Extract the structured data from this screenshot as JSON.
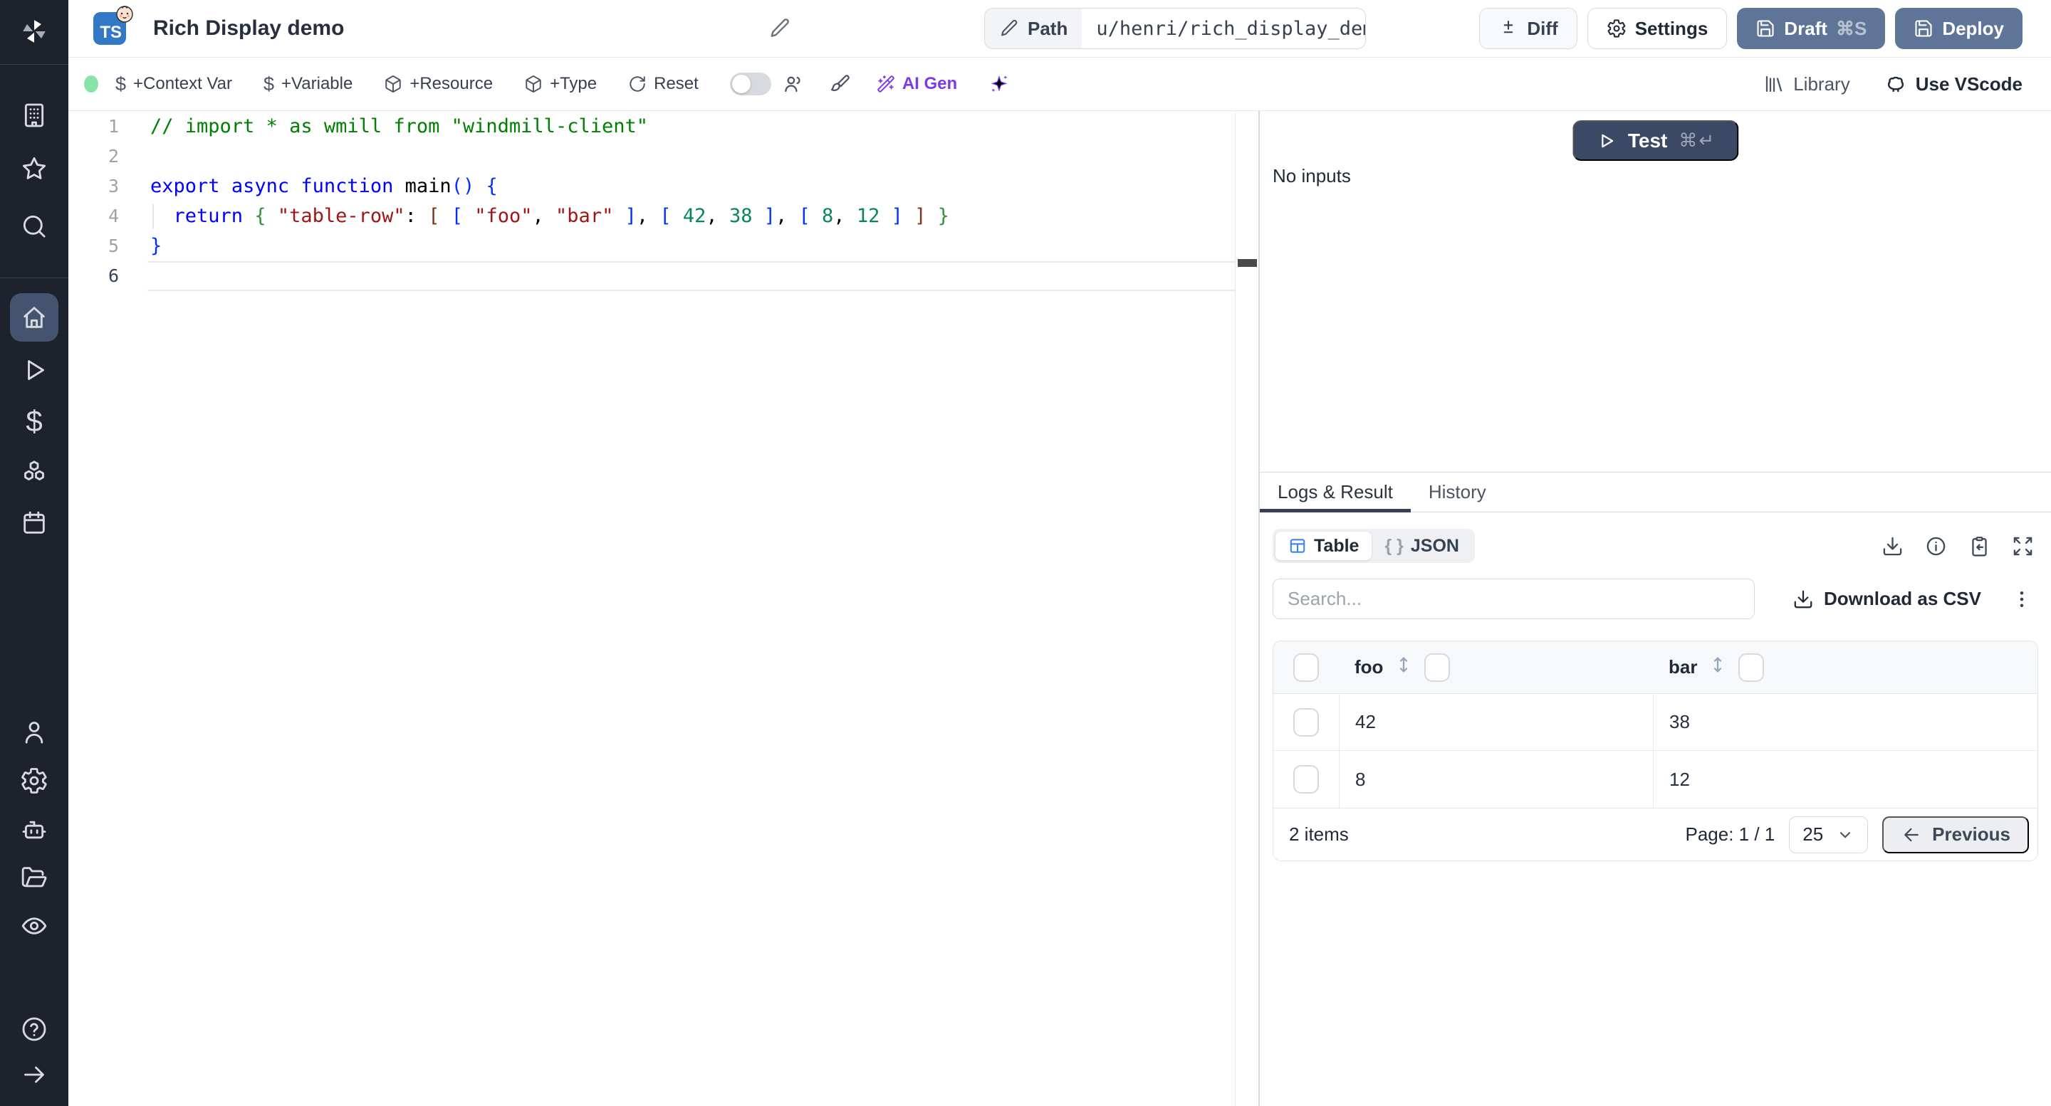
{
  "colors": {
    "accent_blue": "#5f7598",
    "dark_navy": "#3b4964",
    "ai_purple": "#7c3aed",
    "status_green": "#87e3a6",
    "table_icon_blue": "#3b82f6",
    "ts_badge_blue": "#3178c6",
    "sidebar_bg": "#1e222c",
    "sidebar_active_bg": "#44536e"
  },
  "sidebar": {
    "icons": [
      "windmill-logo",
      "building",
      "star",
      "search",
      "home",
      "play",
      "dollar",
      "boxes",
      "calendar",
      "user",
      "settings",
      "worker",
      "folder-open",
      "eye",
      "help",
      "expand-arrow"
    ],
    "active_item": "home"
  },
  "header": {
    "lang_badge": "TS",
    "script_title": "Rich Display demo",
    "path_label": "Path",
    "path_value": "u/henri/rich_display_demo",
    "diff_label": "Diff",
    "settings_label": "Settings",
    "draft_label": "Draft",
    "draft_shortcut": "⌘S",
    "deploy_label": "Deploy"
  },
  "toolbar": {
    "add_context_var": "+Context Var",
    "add_variable": "+Variable",
    "add_resource": "+Resource",
    "add_type": "+Type",
    "reset": "Reset",
    "ai_gen": "AI Gen",
    "library": "Library",
    "use_vscode": "Use VScode"
  },
  "editor": {
    "active_line": 6,
    "lines": [
      {
        "tokens": [
          {
            "t": "// import * as wmill from \"windmill-client\"",
            "c": "cm"
          }
        ]
      },
      {
        "tokens": []
      },
      {
        "tokens": [
          {
            "t": "export",
            "c": "kw"
          },
          {
            "t": " ",
            "c": "pl"
          },
          {
            "t": "async",
            "c": "kw"
          },
          {
            "t": " ",
            "c": "pl"
          },
          {
            "t": "function",
            "c": "kw"
          },
          {
            "t": " main",
            "c": "pl"
          },
          {
            "t": "(",
            "c": "b1"
          },
          {
            "t": ")",
            "c": "b1"
          },
          {
            "t": " ",
            "c": "pl"
          },
          {
            "t": "{",
            "c": "b1"
          }
        ]
      },
      {
        "guide": true,
        "tokens": [
          {
            "t": "  ",
            "c": "pl"
          },
          {
            "t": "return",
            "c": "kw"
          },
          {
            "t": " ",
            "c": "pl"
          },
          {
            "t": "{",
            "c": "b2"
          },
          {
            "t": " ",
            "c": "pl"
          },
          {
            "t": "\"table-row\"",
            "c": "st"
          },
          {
            "t": ": ",
            "c": "pl"
          },
          {
            "t": "[",
            "c": "b3"
          },
          {
            "t": " ",
            "c": "pl"
          },
          {
            "t": "[",
            "c": "b1"
          },
          {
            "t": " ",
            "c": "pl"
          },
          {
            "t": "\"foo\"",
            "c": "st"
          },
          {
            "t": ", ",
            "c": "pl"
          },
          {
            "t": "\"bar\"",
            "c": "st"
          },
          {
            "t": " ",
            "c": "pl"
          },
          {
            "t": "]",
            "c": "b1"
          },
          {
            "t": ", ",
            "c": "pl"
          },
          {
            "t": "[",
            "c": "b1"
          },
          {
            "t": " ",
            "c": "pl"
          },
          {
            "t": "42",
            "c": "nu"
          },
          {
            "t": ", ",
            "c": "pl"
          },
          {
            "t": "38",
            "c": "nu"
          },
          {
            "t": " ",
            "c": "pl"
          },
          {
            "t": "]",
            "c": "b1"
          },
          {
            "t": ", ",
            "c": "pl"
          },
          {
            "t": "[",
            "c": "b1"
          },
          {
            "t": " ",
            "c": "pl"
          },
          {
            "t": "8",
            "c": "nu"
          },
          {
            "t": ", ",
            "c": "pl"
          },
          {
            "t": "12",
            "c": "nu"
          },
          {
            "t": " ",
            "c": "pl"
          },
          {
            "t": "]",
            "c": "b1"
          },
          {
            "t": " ",
            "c": "pl"
          },
          {
            "t": "]",
            "c": "b3"
          },
          {
            "t": " ",
            "c": "pl"
          },
          {
            "t": "}",
            "c": "b2"
          }
        ]
      },
      {
        "tokens": [
          {
            "t": "}",
            "c": "b1"
          }
        ]
      },
      {
        "tokens": []
      }
    ]
  },
  "run_panel": {
    "test_label": "Test",
    "test_shortcut": "⌘↵",
    "no_inputs": "No inputs"
  },
  "result_panel": {
    "tabs": [
      {
        "label": "Logs & Result"
      },
      {
        "label": "History"
      }
    ],
    "view_modes": [
      {
        "label": "Table"
      },
      {
        "label": "JSON"
      }
    ],
    "json_glyph": "{ }",
    "search_placeholder": "Search...",
    "download_csv_label": "Download as CSV",
    "table": {
      "columns": [
        "foo",
        "bar"
      ],
      "rows": [
        [
          "42",
          "38"
        ],
        [
          "8",
          "12"
        ]
      ],
      "items_count": "2 items",
      "page_label": "Page: 1 / 1",
      "page_size": "25",
      "previous_label": "Previous"
    }
  }
}
